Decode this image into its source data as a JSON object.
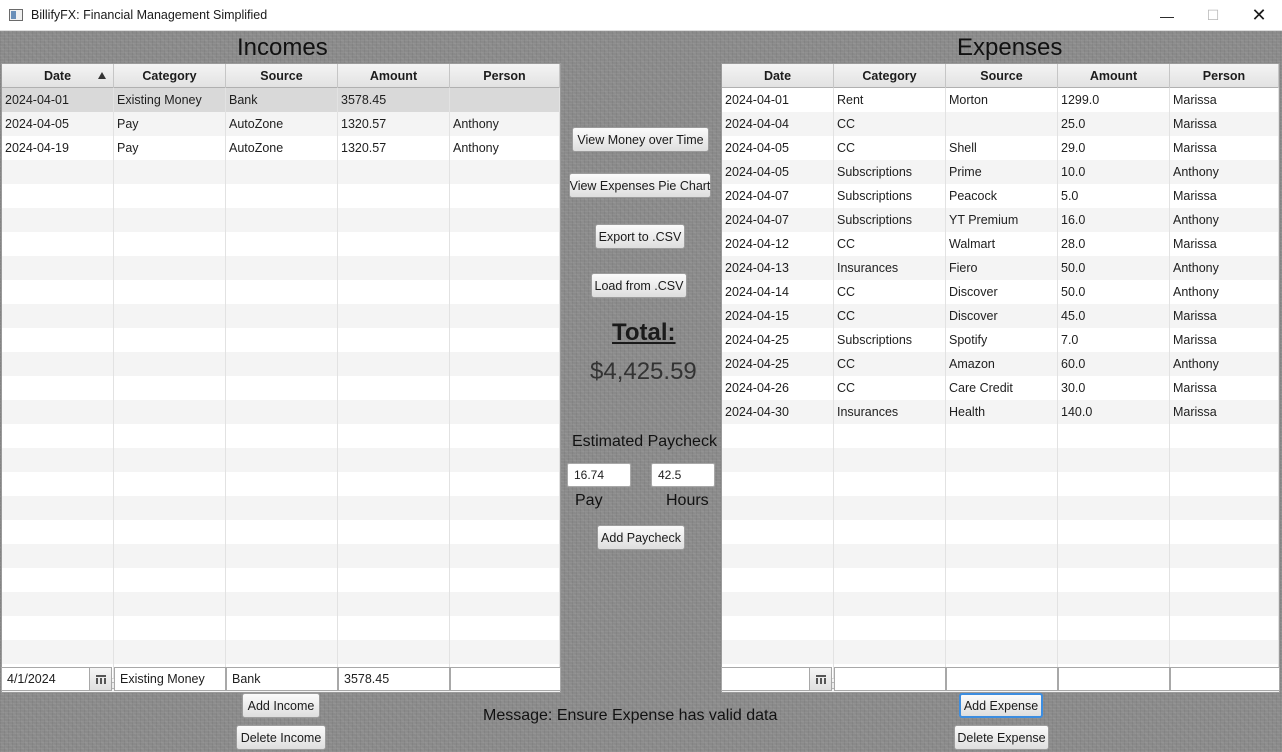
{
  "window": {
    "title": "BillifyFX: Financial Management Simplified",
    "minimize_glyph": "—",
    "maximize_glyph": "☐",
    "close_glyph": "✕"
  },
  "incomes": {
    "title": "Incomes",
    "columns": [
      "Date",
      "Category",
      "Source",
      "Amount",
      "Person"
    ],
    "sorted_column": "Date",
    "rows": [
      [
        "2024-04-01",
        "Existing Money",
        "Bank",
        "3578.45",
        ""
      ],
      [
        "2024-04-05",
        "Pay",
        "AutoZone",
        "1320.57",
        "Anthony"
      ],
      [
        "2024-04-19",
        "Pay",
        "AutoZone",
        "1320.57",
        "Anthony"
      ]
    ],
    "selected_row": 0,
    "form": {
      "date": "4/1/2024",
      "category": "Existing Money",
      "source": "Bank",
      "amount": "3578.45",
      "person": ""
    },
    "add_label": "Add Income",
    "delete_label": "Delete Income"
  },
  "expenses": {
    "title": "Expenses",
    "columns": [
      "Date",
      "Category",
      "Source",
      "Amount",
      "Person"
    ],
    "rows": [
      [
        "2024-04-01",
        "Rent",
        "Morton",
        "1299.0",
        "Marissa"
      ],
      [
        "2024-04-04",
        "CC",
        "",
        "25.0",
        "Marissa"
      ],
      [
        "2024-04-05",
        "CC",
        "Shell",
        "29.0",
        "Marissa"
      ],
      [
        "2024-04-05",
        "Subscriptions",
        "Prime",
        "10.0",
        "Anthony"
      ],
      [
        "2024-04-07",
        "Subscriptions",
        "Peacock",
        "5.0",
        "Marissa"
      ],
      [
        "2024-04-07",
        "Subscriptions",
        "YT Premium",
        "16.0",
        "Anthony"
      ],
      [
        "2024-04-12",
        "CC",
        "Walmart",
        "28.0",
        "Marissa"
      ],
      [
        "2024-04-13",
        "Insurances",
        "Fiero",
        "50.0",
        "Anthony"
      ],
      [
        "2024-04-14",
        "CC",
        "Discover",
        "50.0",
        "Anthony"
      ],
      [
        "2024-04-15",
        "CC",
        "Discover",
        "45.0",
        "Marissa"
      ],
      [
        "2024-04-25",
        "Subscriptions",
        "Spotify",
        "7.0",
        "Marissa"
      ],
      [
        "2024-04-25",
        "CC",
        "Amazon",
        "60.0",
        "Anthony"
      ],
      [
        "2024-04-26",
        "CC",
        "Care Credit",
        "30.0",
        "Marissa"
      ],
      [
        "2024-04-30",
        "Insurances",
        "Health",
        "140.0",
        "Marissa"
      ]
    ],
    "form": {
      "date": "",
      "category": "",
      "source": "",
      "amount": "",
      "person": ""
    },
    "add_label": "Add Expense",
    "delete_label": "Delete Expense"
  },
  "center": {
    "view_money_label": "View Money over Time",
    "view_pie_label": "View Expenses Pie Chart",
    "export_label": "Export to .CSV",
    "load_label": "Load from .CSV",
    "total_label": "Total:",
    "total_value": "$4,425.59",
    "estimated_label": "Estimated Paycheck",
    "pay_value": "16.74",
    "hours_value": "42.5",
    "pay_label": "Pay",
    "hours_label": "Hours",
    "add_paycheck_label": "Add Paycheck"
  },
  "message": "Message: Ensure Expense has valid data",
  "colors": {
    "background": "#8a8a8a",
    "selected_row": "#d9d9d9",
    "focus_ring": "#3c8de0"
  }
}
